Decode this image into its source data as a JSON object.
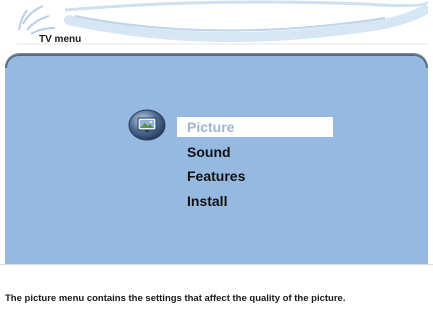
{
  "header": {
    "title": "TV menu"
  },
  "menu": {
    "items": [
      {
        "label": "Picture",
        "selected": true
      },
      {
        "label": "Sound",
        "selected": false
      },
      {
        "label": "Features",
        "selected": false
      },
      {
        "label": "Install",
        "selected": false
      }
    ],
    "selected_icon": "picture-icon"
  },
  "footer": {
    "help_text": "The picture menu contains the settings that affect the quality of the picture."
  },
  "colors": {
    "panel_background": "#96b9e2",
    "panel_border": "#5a6a80",
    "selected_item_background": "#ffffff",
    "selected_item_text": "#9eb6d2",
    "item_text": "#111111"
  }
}
